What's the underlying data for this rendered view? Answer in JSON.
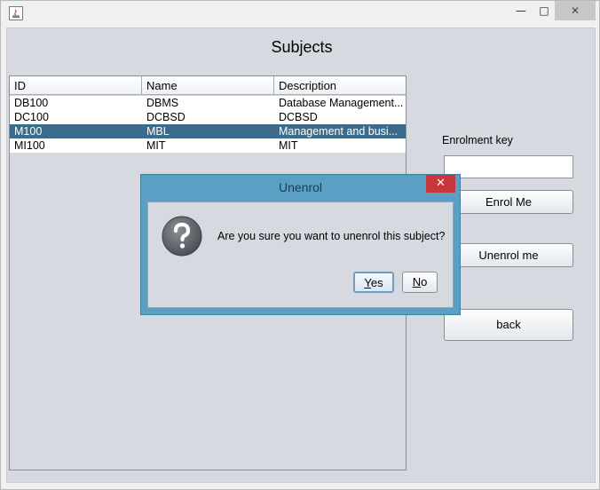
{
  "window": {
    "controls": {
      "minimize": "—",
      "maximize": "□",
      "close": "✕"
    }
  },
  "page_title": "Subjects",
  "table": {
    "columns": [
      "ID",
      "Name",
      "Description"
    ],
    "rows": [
      {
        "id": "DB100",
        "name": "DBMS",
        "description": "Database Management..."
      },
      {
        "id": "DC100",
        "name": "DCBSD",
        "description": "DCBSD"
      },
      {
        "id": "M100",
        "name": "MBL",
        "description": "Management and busi...",
        "selected": true
      },
      {
        "id": "MI100",
        "name": "MIT",
        "description": "MIT"
      }
    ]
  },
  "enrol": {
    "label": "Enrolment key",
    "value": "",
    "enrol_button": "Enrol Me",
    "unenrol_button": "Unenrol me",
    "back_button": "back"
  },
  "dialog": {
    "title": "Unenrol",
    "close": "✕",
    "message": "Are you sure you want to unenrol this subject?",
    "yes_mnemonic": "Y",
    "yes_rest": "es",
    "no_mnemonic": "N",
    "no_rest": "o",
    "icon": "question-icon"
  },
  "colors": {
    "selection": "#3c6b8c",
    "dialog_frame": "#5aa0c4",
    "dialog_close": "#c7383b",
    "panel": "#d6d9df"
  }
}
